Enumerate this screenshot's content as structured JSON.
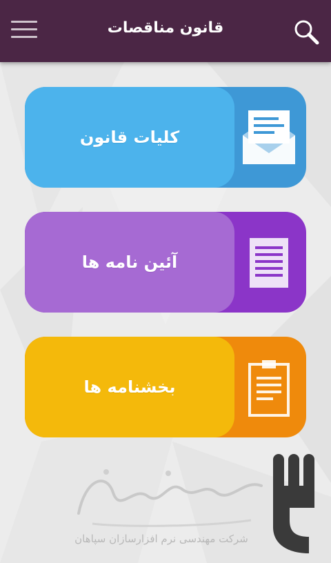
{
  "app": {
    "title": "قانون مناقصات"
  },
  "header": {
    "menu_icon": "hamburger-menu-icon",
    "search_icon": "search-icon"
  },
  "cards": [
    {
      "label": "کلیات قانون",
      "icon": "envelope-icon",
      "accent": "#3e98d6",
      "fill": "#4cb3ec"
    },
    {
      "label": "آئین نامه ها",
      "icon": "document-icon",
      "accent": "#8b35c8",
      "fill": "#a66ad3"
    },
    {
      "label": "بخشنامه ها",
      "icon": "clipboard-icon",
      "accent": "#ef8a0c",
      "fill": "#f4b90b"
    }
  ],
  "footer": {
    "watermark_text": "شرکت مهندسی نرم افزارسازان سپاهان",
    "watermark_logo_text": "نرم افزارسازان"
  },
  "colors": {
    "appbar": "#4b2645",
    "background": "#ececec"
  }
}
